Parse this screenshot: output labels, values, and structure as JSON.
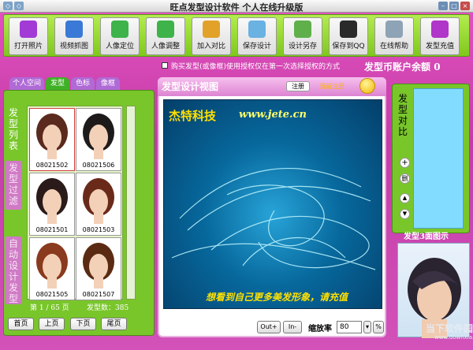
{
  "window": {
    "title": "旺点发型设计软件  个人在线升级版"
  },
  "toolbar": {
    "buttons": [
      {
        "label": "打开照片",
        "icon": "open-photo-icon",
        "color": "#a23bd6"
      },
      {
        "label": "视频抓图",
        "icon": "video-capture-icon",
        "color": "#3b79d6"
      },
      {
        "label": "人像定位",
        "icon": "portrait-locate-icon",
        "color": "#3eb34a"
      },
      {
        "label": "人像调整",
        "icon": "portrait-adjust-icon",
        "color": "#3eb34a"
      },
      {
        "label": "加入对比",
        "icon": "add-compare-icon",
        "color": "#e2a22a"
      },
      {
        "label": "保存设计",
        "icon": "save-design-icon",
        "color": "#6ab2e2"
      },
      {
        "label": "设计另存",
        "icon": "save-as-icon",
        "color": "#5fb04b"
      },
      {
        "label": "保存到QQ",
        "icon": "qq-penguin-icon",
        "color": "#2a2a2a"
      },
      {
        "label": "在线帮助",
        "icon": "online-help-icon",
        "color": "#8ea3b5"
      },
      {
        "label": "发型充值",
        "icon": "hairstyle-recharge-icon",
        "color": "#b035c9"
      }
    ]
  },
  "notice": {
    "buy_text": "购买发型(或像框)使用授权仅在第一次选择授权的方式",
    "balance_label": "发型币账户余额",
    "balance_value": "0"
  },
  "left_tabs": [
    {
      "label": "个人空间",
      "color": "#b06ad6"
    },
    {
      "label": "发型",
      "color": "#3fb126"
    },
    {
      "label": "色标",
      "color": "#b06ad6"
    },
    {
      "label": "像框",
      "color": "#b06ad6"
    }
  ],
  "side_labels": {
    "list": "发\n型\n列\n表",
    "filter": "发\n型\n过\n滤",
    "auto": "自\n动\n设\n计\n发\n型"
  },
  "hairstyles": [
    {
      "code": "08021502"
    },
    {
      "code": "08021506"
    },
    {
      "code": "08021501"
    },
    {
      "code": "08021503"
    },
    {
      "code": "08021505"
    },
    {
      "code": "08021507"
    }
  ],
  "paging": {
    "page_info": "第 1 / 65 页",
    "count_label": "发型数：385",
    "first": "首页",
    "prev": "上页",
    "next": "下页",
    "last": "尾页"
  },
  "view": {
    "title": "发型设计视图",
    "register": "注册",
    "reg_note": "当前注册",
    "brand": "杰特科技",
    "url": "www.jete.cn",
    "promo": "想看到自己更多美发形象，请充值"
  },
  "zoom": {
    "out": "Out+",
    "in": "In-",
    "label": "缩放率",
    "value": "80",
    "unit": "%"
  },
  "right": {
    "compare_label": "发\n型\n对\n比",
    "add": "+",
    "delete": "删",
    "up": "▲",
    "down": "▼",
    "face3d_title": "发型3面图示"
  },
  "watermark": {
    "line1": "当下软件园",
    "line2": "www.downxia.com"
  }
}
